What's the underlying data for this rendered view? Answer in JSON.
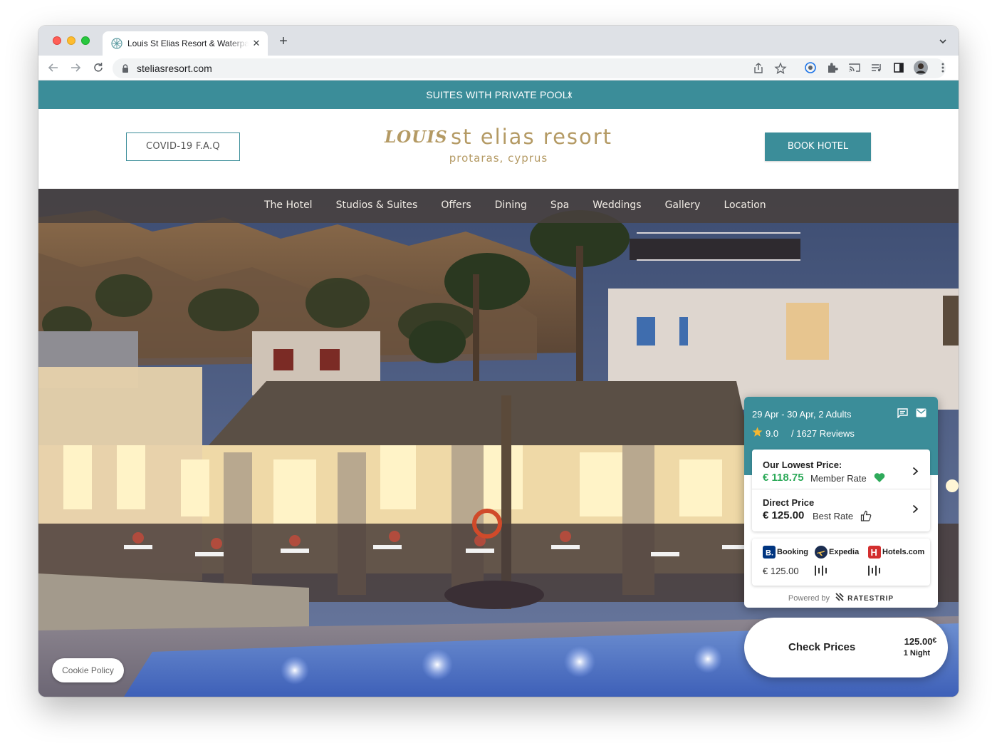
{
  "browser": {
    "tab_title": "Louis St Elias Resort & Waterpark",
    "tab_close": "✕",
    "new_tab": "+",
    "url": "steliasresort.com"
  },
  "promo": {
    "text": "SUITES WITH PRIVATE POOL!",
    "close": "x"
  },
  "header": {
    "covid_button": "COVID-19 F.A.Q",
    "logo_brand": "LOUIS",
    "logo_name": "st elias resort",
    "logo_sub": "protaras, cyprus",
    "book_button": "BOOK HOTEL"
  },
  "nav": {
    "items": [
      "The Hotel",
      "Studios & Suites",
      "Offers",
      "Dining",
      "Spa",
      "Weddings",
      "Gallery",
      "Location"
    ]
  },
  "rate_widget": {
    "dates": "29 Apr - 30 Apr, 2 Adults",
    "rating": "9.0",
    "reviews": "/  1627 Reviews",
    "lowest_title": "Our Lowest Price:",
    "lowest_price": "€ 118.75",
    "lowest_tag": "Member Rate",
    "direct_title": "Direct Price",
    "direct_price": "€ 125.00",
    "direct_tag": "Best Rate",
    "otas": [
      {
        "name": "Booking",
        "value": "€ 125.00",
        "logo_color": "#003580"
      },
      {
        "name": "Expedia",
        "value": "",
        "logo_color": "#1b2d50"
      },
      {
        "name": "Hotels.com",
        "value": "",
        "logo_color": "#d32f2f"
      }
    ],
    "powered_by": "Powered by",
    "powered_brand": "RATESTRIP",
    "accent_color": "#3b8d99",
    "member_color": "#2eaa5a"
  },
  "check_prices": {
    "label": "Check Prices",
    "price": "125.00",
    "currency": "€",
    "nights": "1 Night"
  },
  "cookie": {
    "label": "Cookie Policy"
  }
}
